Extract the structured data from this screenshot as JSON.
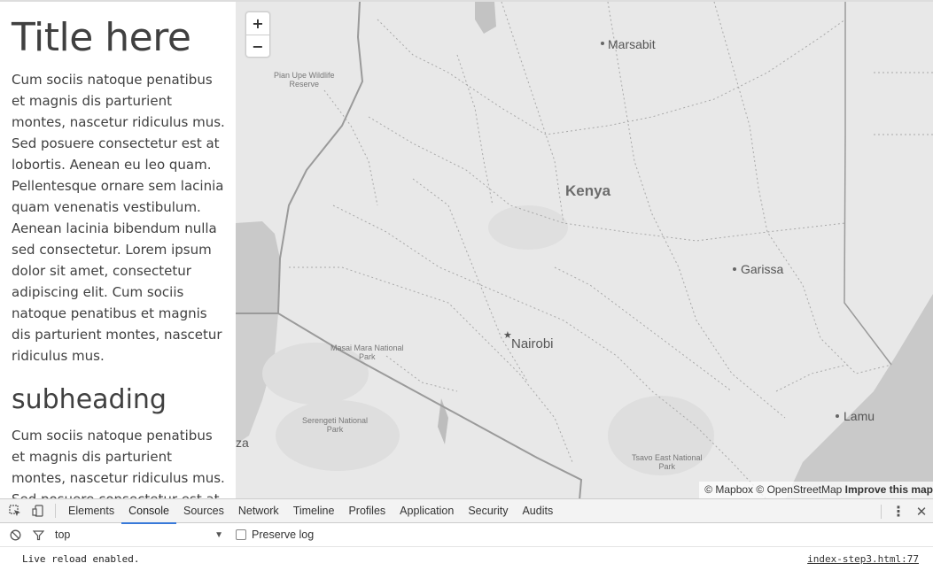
{
  "sidebar": {
    "title": "Title here",
    "paragraph1": "Cum sociis natoque penatibus et magnis dis parturient montes, nascetur ridiculus mus. Sed posuere consectetur est at lobortis. Aenean eu leo quam. Pellentesque ornare sem lacinia quam venenatis vestibulum. Aenean lacinia bibendum nulla sed consectetur. Lorem ipsum dolor sit amet, consectetur adipiscing elit. Cum sociis natoque penatibus et magnis dis parturient montes, nascetur ridiculus mus.",
    "subheading": "subheading",
    "paragraph2": "Cum sociis natoque penatibus et magnis dis parturient montes, nascetur ridiculus mus. Sed posuere consectetur est at lobortis."
  },
  "map": {
    "zoom_in": "+",
    "zoom_out": "−",
    "labels": {
      "marsabit": "Marsabit",
      "kenya": "Kenya",
      "garissa": "Garissa",
      "nairobi": "Nairobi",
      "lamu": "Lamu",
      "pian_upe_1": "Pian Upe Wildlife",
      "pian_upe_2": "Reserve",
      "masai_mara_1": "Masai Mara National",
      "masai_mara_2": "Park",
      "serengeti_1": "Serengeti National",
      "serengeti_2": "Park",
      "tsavo_1": "Tsavo East National",
      "tsavo_2": "Park",
      "za": "za"
    },
    "attribution": {
      "mapbox": "© Mapbox",
      "osm": "© OpenStreetMap",
      "improve": "Improve this map"
    }
  },
  "devtools": {
    "tabs": [
      "Elements",
      "Console",
      "Sources",
      "Network",
      "Timeline",
      "Profiles",
      "Application",
      "Security",
      "Audits"
    ],
    "active_tab": "Console",
    "context": "top",
    "preserve_log": "Preserve log",
    "console_message": "Live reload enabled.",
    "console_source": "index-step3.html:77"
  },
  "colors": {
    "active_tab_underline": "#3879d9",
    "water": "#c8c8c8",
    "land": "#e8e8e8"
  }
}
